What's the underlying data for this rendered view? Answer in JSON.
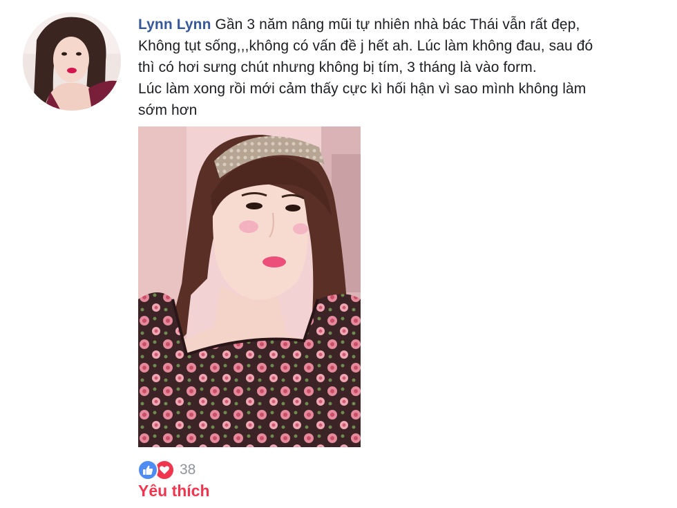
{
  "comment": {
    "author": "Lynn Lynn",
    "text": " Gần 3 năm nâng mũi tự nhiên nhà bác Thái vẫn rất đẹp,\nKhông tụt sống,,,không có vấn đề j hết ah. Lúc làm không đau, sau đó\nthì có hơi sưng chút nhưng không bị tím, 3 tháng là vào form.\nLúc làm xong rồi mới cảm thấy cực kì hối hận vì sao mình không làm\nsớm hơn"
  },
  "reactions": {
    "icons": [
      "thumbs-up-icon",
      "heart-icon"
    ],
    "count": "38",
    "selected_label": "Yêu thích",
    "colors": {
      "like": "#4f8cf5",
      "love": "#f0364f",
      "author": "#365899"
    }
  }
}
